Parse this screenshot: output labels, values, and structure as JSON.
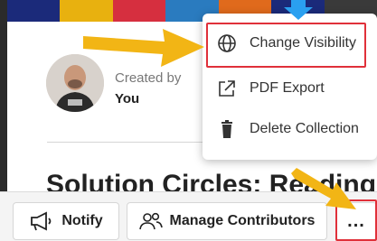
{
  "banner_colors": [
    "#1b2a7a",
    "#e8b10f",
    "#d62f3f",
    "#2a7bbf",
    "#e06a1c",
    "#1b2a7a",
    "#3a3a3a"
  ],
  "creator": {
    "label": "Created by",
    "name": "You"
  },
  "collection": {
    "title": "Solution Circles: Reading"
  },
  "menu": {
    "items": [
      {
        "label": "Change Visibility",
        "icon": "globe-icon"
      },
      {
        "label": "PDF Export",
        "icon": "external-link-icon"
      },
      {
        "label": "Delete Collection",
        "icon": "trash-icon"
      }
    ]
  },
  "actions": {
    "notify": {
      "label": "Notify",
      "icon": "megaphone-icon"
    },
    "manage_contributors": {
      "label": "Manage Contributors",
      "icon": "people-icon"
    },
    "more": {
      "label": "...",
      "icon": "more-dots-icon"
    }
  },
  "colors": {
    "highlight": "#e0303a",
    "arrow_yellow": "#f2b515",
    "arrow_blue": "#2aa0f0"
  }
}
